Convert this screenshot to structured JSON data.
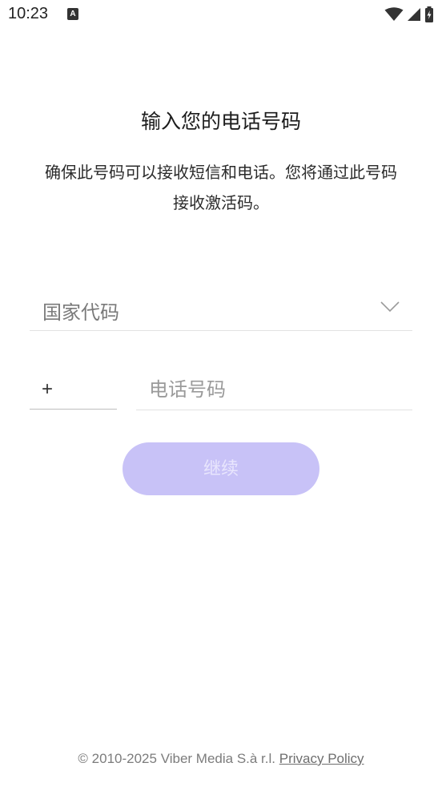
{
  "status_bar": {
    "time": "10:23",
    "notification_icon": "A"
  },
  "header": {
    "title": "输入您的电话号码",
    "subtitle": "确保此号码可以接收短信和电话。您将通过此号码接收激活码。"
  },
  "country_select": {
    "placeholder": "国家代码"
  },
  "phone": {
    "country_code_prefix": "+",
    "number_placeholder": "电话号码",
    "number_value": ""
  },
  "actions": {
    "continue_label": "继续"
  },
  "footer": {
    "copyright": "© 2010-2025 Viber Media S.à r.l.",
    "privacy_link": "Privacy Policy"
  },
  "colors": {
    "accent_disabled": "#c8c2f7",
    "button_text_disabled": "#e9e6fd"
  }
}
